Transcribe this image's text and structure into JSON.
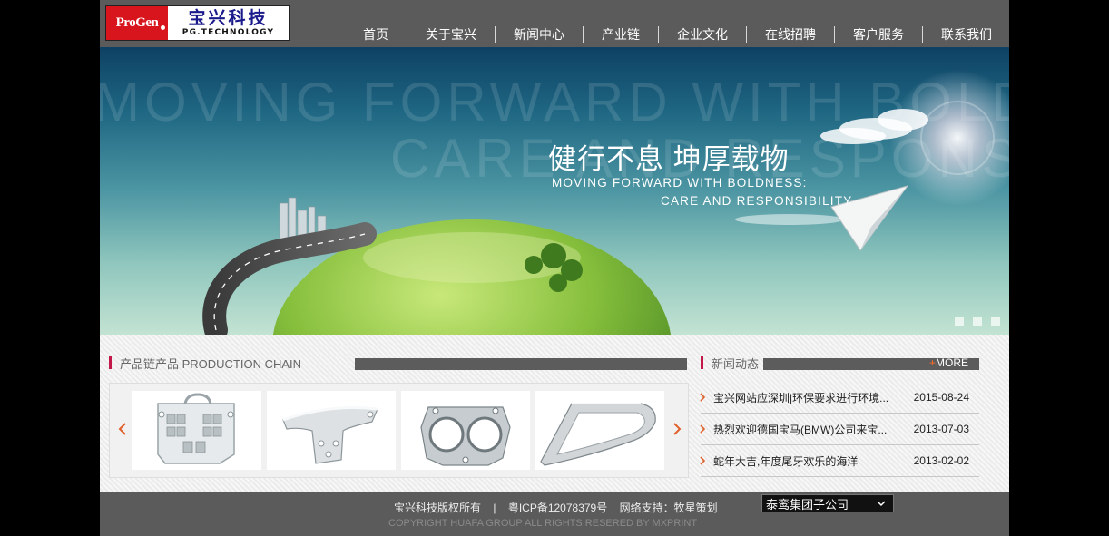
{
  "header": {
    "logo": {
      "mark": "ProGen",
      "cn": "宝兴科技",
      "en": "PG.TECHNOLOGY"
    },
    "nav": [
      "首页",
      "关于宝兴",
      "新闻中心",
      "产业链",
      "企业文化",
      "在线招聘",
      "客户服务",
      "联系我们"
    ]
  },
  "banner": {
    "bg_line1": "MOVING FORWARD WITH BOLDNESS",
    "bg_line2": "CARE AND RESPONSIBILITY",
    "slogan_cn": "健行不息  坤厚载物",
    "slogan_en_1": "MOVING FORWARD WITH BOLDNESS:",
    "slogan_en_2": "CARE AND RESPONSIBILITY",
    "slide_count": 3
  },
  "products": {
    "title": "产品链产品 PRODUCTION CHAIN",
    "items": [
      "bracket-part-image",
      "steel-bracket-image",
      "dual-ring-part-image",
      "chrome-trim-image"
    ]
  },
  "news": {
    "title": "新闻动态",
    "more": "MORE",
    "items": [
      {
        "title": "宝兴网站应深圳|环保要求进行环境...",
        "date": "2015-08-24"
      },
      {
        "title": "热烈欢迎德国宝马(BMW)公司来宝...",
        "date": "2013-07-03"
      },
      {
        "title": "蛇年大吉,年度尾牙欢乐的海洋",
        "date": "2013-02-02"
      }
    ]
  },
  "footer": {
    "copyright": "宝兴科技版权所有",
    "separator": "|",
    "icp": "粤ICP备12078379号",
    "support_label": "网络支持：牧星策划",
    "copyright_en": "COPYRIGHT HUAFA GROUP ALL RIGHTS RESERED BY MXPRINT",
    "select_value": "泰鸾集团子公司"
  },
  "colors": {
    "header": "#5b5b5b",
    "accent": "#c2184a",
    "arrow": "#e0612a",
    "logo_red": "#d8141c"
  }
}
